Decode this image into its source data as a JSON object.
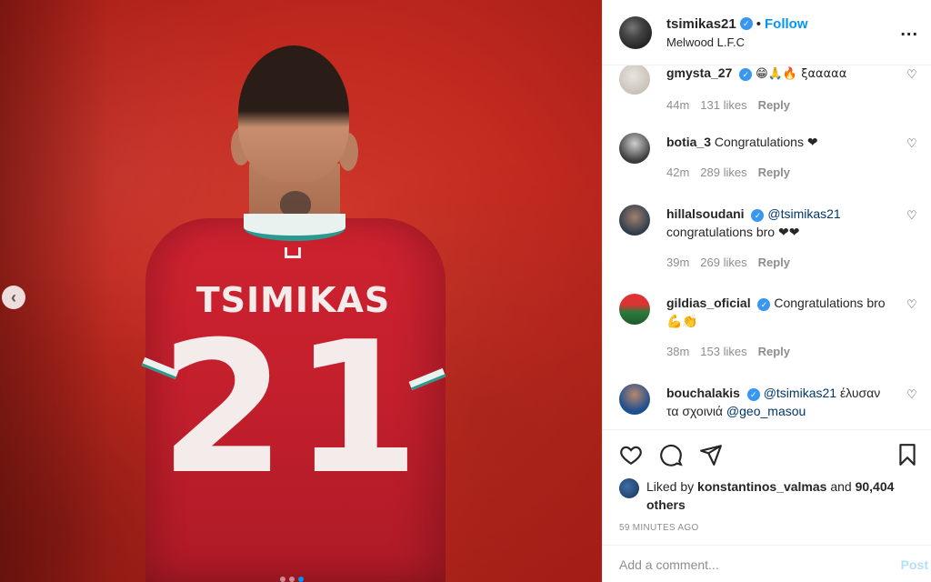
{
  "post_image": {
    "jersey_name": "TSIMIKAS",
    "jersey_number": "21",
    "carousel_prev_glyph": "‹",
    "carousel_dots": 3,
    "carousel_active_index": 2
  },
  "header": {
    "username": "tsimikas21",
    "separator": "•",
    "follow_label": "Follow",
    "location": "Melwood L.F.C",
    "more_glyph": "..."
  },
  "comments": [
    {
      "user": "gmysta_27",
      "verified": true,
      "text": "😁🙏🔥 ξααααα",
      "time": "44m",
      "likes": "131 likes",
      "reply": "Reply"
    },
    {
      "user": "botia_3",
      "verified": false,
      "text": "Congratulations ❤",
      "time": "42m",
      "likes": "289 likes",
      "reply": "Reply"
    },
    {
      "user": "hillalsoudani",
      "verified": true,
      "mention": "@tsimikas21",
      "text": "congratulations bro ❤❤",
      "time": "39m",
      "likes": "269 likes",
      "reply": "Reply"
    },
    {
      "user": "gildias_oficial",
      "verified": true,
      "text": "Congratulations bro 💪👏",
      "time": "38m",
      "likes": "153 likes",
      "reply": "Reply"
    },
    {
      "user": "bouchalakis",
      "verified": true,
      "mention": "@tsimikas21",
      "text": "έλυσαν τα σχοινιά",
      "mention2": "@geo_masou"
    }
  ],
  "liked_by": {
    "prefix": "Liked by",
    "user": "konstantinos_valmas",
    "connector": "and",
    "others": "90,404 others"
  },
  "timestamp": "59 MINUTES AGO",
  "add_comment": {
    "placeholder": "Add a comment...",
    "post_label": "Post"
  },
  "colors": {
    "link_blue": "#0095f6",
    "verified_blue": "#3897f0",
    "muted_text": "#8e8e8e",
    "heart_red": "#ed4956",
    "post_disabled": "#b2dffc"
  },
  "icons": [
    "heart-icon",
    "comment-icon",
    "share-icon",
    "bookmark-icon",
    "verified-icon",
    "more-icon",
    "chevron-left-icon"
  ]
}
